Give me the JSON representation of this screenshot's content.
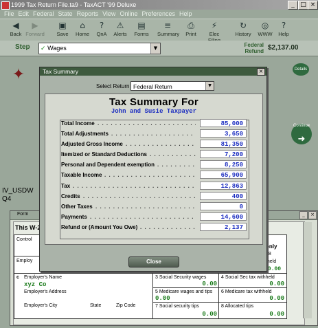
{
  "window": {
    "title": "1999 Tax Return File.ta9 - TaxACT '99 Deluxe",
    "min_glyph": "_",
    "max_glyph": "□",
    "close_glyph": "×"
  },
  "menu": [
    "File",
    "Edit",
    "Federal",
    "State",
    "Reports",
    "View",
    "Online",
    "Preferences",
    "Help"
  ],
  "toolbar": [
    {
      "label": "Back",
      "icon": "back-arrow-icon",
      "glyph": "◀",
      "enabled": true
    },
    {
      "label": "Forward",
      "icon": "forward-arrow-icon",
      "glyph": "▶",
      "enabled": false
    },
    {
      "label": "Save",
      "icon": "save-icon",
      "glyph": "▣",
      "enabled": true
    },
    {
      "label": "Home",
      "icon": "home-icon",
      "glyph": "⌂",
      "enabled": true
    },
    {
      "label": "QnA",
      "icon": "qna-icon",
      "glyph": "?",
      "enabled": true
    },
    {
      "label": "Alerts",
      "icon": "alerts-icon",
      "glyph": "⚠",
      "enabled": true
    },
    {
      "label": "Forms",
      "icon": "forms-icon",
      "glyph": "▤",
      "enabled": true
    },
    {
      "label": "Summary",
      "icon": "summary-icon",
      "glyph": "≡",
      "enabled": true
    },
    {
      "label": "Print",
      "icon": "print-icon",
      "glyph": "⎙",
      "enabled": true
    },
    {
      "label": "Elec Filing",
      "icon": "elec-filing-icon",
      "glyph": "⚡",
      "enabled": true
    },
    {
      "label": "History",
      "icon": "history-icon",
      "glyph": "↻",
      "enabled": true
    },
    {
      "label": "WWW",
      "icon": "www-icon",
      "glyph": "◎",
      "enabled": true
    },
    {
      "label": "Help",
      "icon": "help-icon",
      "glyph": "?",
      "enabled": true
    }
  ],
  "stepbar": {
    "label": "Step",
    "selected": "Wages",
    "refund_label_1": "Federal",
    "refund_label_2": "Refund",
    "refund_amount": "$2,137.00"
  },
  "side": {
    "details": "Details",
    "continue": "Continue",
    "usdw": "IV_USDW",
    "q4": "Q4"
  },
  "form": {
    "tab": "Form",
    "w2_title": "This W-2 b",
    "box_a": "Control",
    "box_b": "Employ",
    "only": "only",
    "omb": "08",
    "withheld": "hheld",
    "employer_name_label": "Employer's Name",
    "employer_name": "xyz Co",
    "employer_address_label": "Employer's Address",
    "city_label": "Employer's City",
    "state_label": "State",
    "zip_label": "Zip Code",
    "box3": "3 Social Security wages",
    "box4": "4 Social Sec tax withheld",
    "box5": "5 Medicare wages and tips",
    "box6": "6 Medicare tax withheld",
    "box7": "7 Social security tips",
    "box8": "8 Allocated tips",
    "zero": "0.00"
  },
  "dialog": {
    "title": "Tax Summary",
    "close_glyph": "×",
    "select_label": "Select Return",
    "select_value": "Federal Return",
    "heading": "Tax Summary For",
    "names": "John and Susie Taxpayer",
    "rows": [
      {
        "label": "Total Income",
        "value": "85,000"
      },
      {
        "label": "Total Adjustments",
        "value": "3,650"
      },
      {
        "label": "Adjusted Gross Income",
        "value": "81,350"
      },
      {
        "label": "Itemized or Standard Deductions",
        "value": "7,200"
      },
      {
        "label": "Personal and Dependent exemption",
        "value": "8,250"
      },
      {
        "label": "Taxable Income",
        "value": "65,900"
      },
      {
        "label": "Tax",
        "value": "12,863"
      },
      {
        "label": "Credits",
        "value": "400"
      },
      {
        "label": "Other Taxes",
        "value": "0"
      },
      {
        "label": "Payments",
        "value": "14,600"
      },
      {
        "label": "Refund or (Amount You Owe)",
        "value": "2,137"
      }
    ],
    "close_button": "Close"
  }
}
